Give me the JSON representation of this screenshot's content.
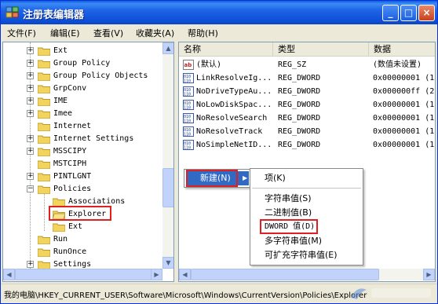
{
  "window": {
    "title": "注册表编辑器",
    "controls": {
      "minimize": "_",
      "maximize": "□",
      "close": "×"
    }
  },
  "menubar": {
    "items": [
      "文件(F)",
      "编辑(E)",
      "查看(V)",
      "收藏夹(A)",
      "帮助(H)"
    ]
  },
  "tree": {
    "items": [
      {
        "label": "Ext",
        "expander": "+"
      },
      {
        "label": "Group Policy",
        "expander": "+"
      },
      {
        "label": "Group Policy Objects",
        "expander": "+"
      },
      {
        "label": "GrpConv",
        "expander": "+"
      },
      {
        "label": "IME",
        "expander": "+"
      },
      {
        "label": "Imee",
        "expander": "+"
      },
      {
        "label": "Internet",
        "expander": ""
      },
      {
        "label": "Internet Settings",
        "expander": "+"
      },
      {
        "label": "MSSCIPY",
        "expander": "+"
      },
      {
        "label": "MSTCIPH",
        "expander": ""
      },
      {
        "label": "PINTLGNT",
        "expander": "+"
      },
      {
        "label": "Policies",
        "expander": "−"
      },
      {
        "label": "Associations",
        "expander": ""
      },
      {
        "label": "Explorer",
        "expander": "",
        "selected": true
      },
      {
        "label": "Ext",
        "expander": ""
      },
      {
        "label": "Run",
        "expander": ""
      },
      {
        "label": "RunOnce",
        "expander": ""
      },
      {
        "label": "Settings",
        "expander": "+"
      }
    ]
  },
  "list": {
    "columns": [
      "名称",
      "类型",
      "数据"
    ],
    "rows": [
      {
        "icon": "string-value-icon",
        "name": "(默认)",
        "type": "REG_SZ",
        "data": "(数值未设置)"
      },
      {
        "icon": "dword-value-icon",
        "name": "LinkResolveIg...",
        "type": "REG_DWORD",
        "data": "0x00000001 (1"
      },
      {
        "icon": "dword-value-icon",
        "name": "NoDriveTypeAu...",
        "type": "REG_DWORD",
        "data": "0x000000ff (2"
      },
      {
        "icon": "dword-value-icon",
        "name": "NoLowDiskSpac...",
        "type": "REG_DWORD",
        "data": "0x00000001 (1"
      },
      {
        "icon": "dword-value-icon",
        "name": "NoResolveSearch",
        "type": "REG_DWORD",
        "data": "0x00000001 (1"
      },
      {
        "icon": "dword-value-icon",
        "name": "NoResolveTrack",
        "type": "REG_DWORD",
        "data": "0x00000001 (1"
      },
      {
        "icon": "dword-value-icon",
        "name": "NoSimpleNetID...",
        "type": "REG_DWORD",
        "data": "0x00000001 (1"
      }
    ]
  },
  "context_menu": {
    "new_label": "新建(N)",
    "submenu": {
      "key": "项(K)",
      "string_value": "字符串值(S)",
      "binary_value": "二进制值(B)",
      "dword_value": "DWORD 值(D)",
      "multi_string_value": "多字符串值(M)",
      "expandable_string_value": "可扩充字符串值(E)"
    }
  },
  "statusbar": {
    "path": "我的电脑\\HKEY_CURRENT_USER\\Software\\Microsoft\\Windows\\CurrentVersion\\Policies\\Explorer"
  },
  "colors": {
    "title_blue": "#0b46c4",
    "highlight_red": "#e02020",
    "selection_blue": "#316ac5",
    "folder_yellow": "#f2d35b"
  }
}
